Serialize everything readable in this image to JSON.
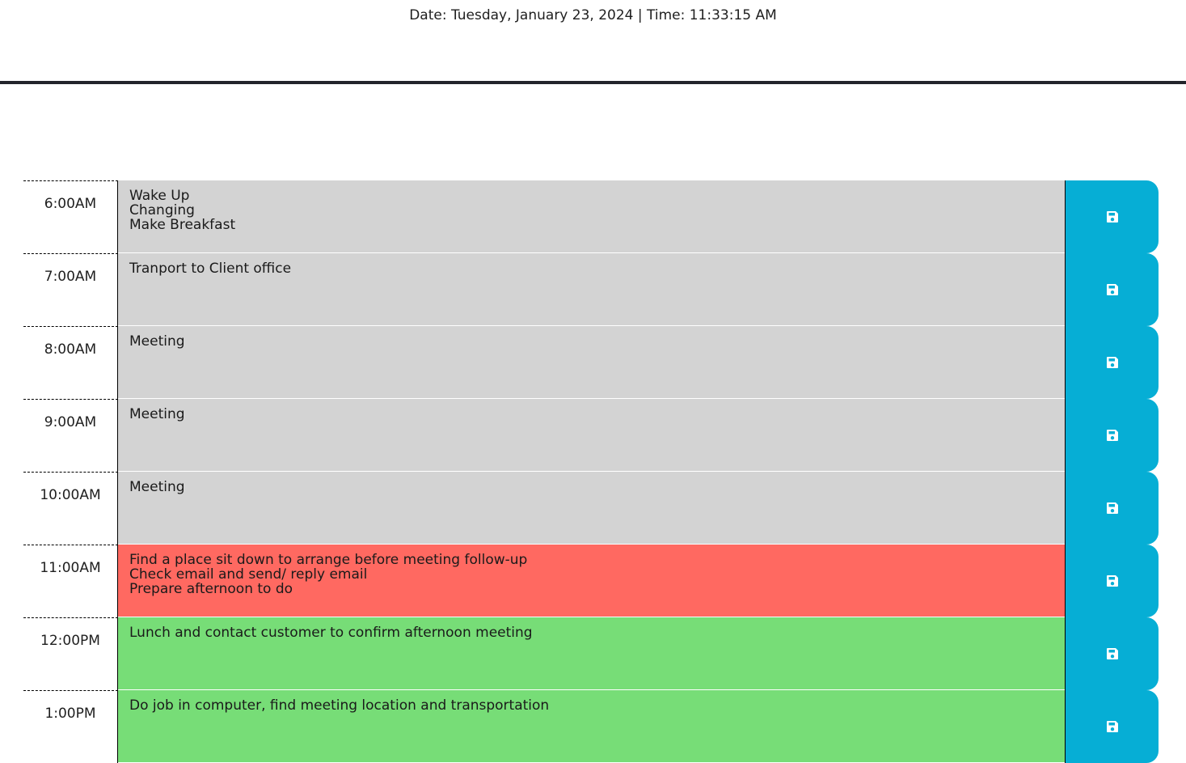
{
  "header": {
    "datetime": "Date: Tuesday, January 23, 2024 | Time: 11:33:15 AM"
  },
  "colors": {
    "past": "#d3d3d3",
    "present": "#ff6961",
    "future": "#77dd77",
    "save": "#06aed5"
  },
  "rows": [
    {
      "hour": "6:00AM",
      "state": "past",
      "lines": [
        "Wake Up",
        "Changing",
        "Make Breakfast"
      ],
      "save_icon": "floppy-disk-icon"
    },
    {
      "hour": "7:00AM",
      "state": "past",
      "lines": [
        "Tranport to Client office"
      ],
      "save_icon": "floppy-disk-icon"
    },
    {
      "hour": "8:00AM",
      "state": "past",
      "lines": [
        "Meeting"
      ],
      "save_icon": "floppy-disk-icon"
    },
    {
      "hour": "9:00AM",
      "state": "past",
      "lines": [
        "Meeting"
      ],
      "save_icon": "floppy-disk-icon"
    },
    {
      "hour": "10:00AM",
      "state": "past",
      "lines": [
        "Meeting"
      ],
      "save_icon": "floppy-disk-icon"
    },
    {
      "hour": "11:00AM",
      "state": "present",
      "lines": [
        "Find a place sit down to arrange before meeting follow-up",
        "Check email and send/ reply email",
        "Prepare afternoon to do"
      ],
      "save_icon": "floppy-disk-icon"
    },
    {
      "hour": "12:00PM",
      "state": "future",
      "lines": [
        "Lunch and contact customer to confirm afternoon meeting"
      ],
      "save_icon": "floppy-disk-icon"
    },
    {
      "hour": "1:00PM",
      "state": "future",
      "lines": [
        "Do job in computer, find meeting location and transportation"
      ],
      "save_icon": "floppy-disk-icon"
    }
  ]
}
